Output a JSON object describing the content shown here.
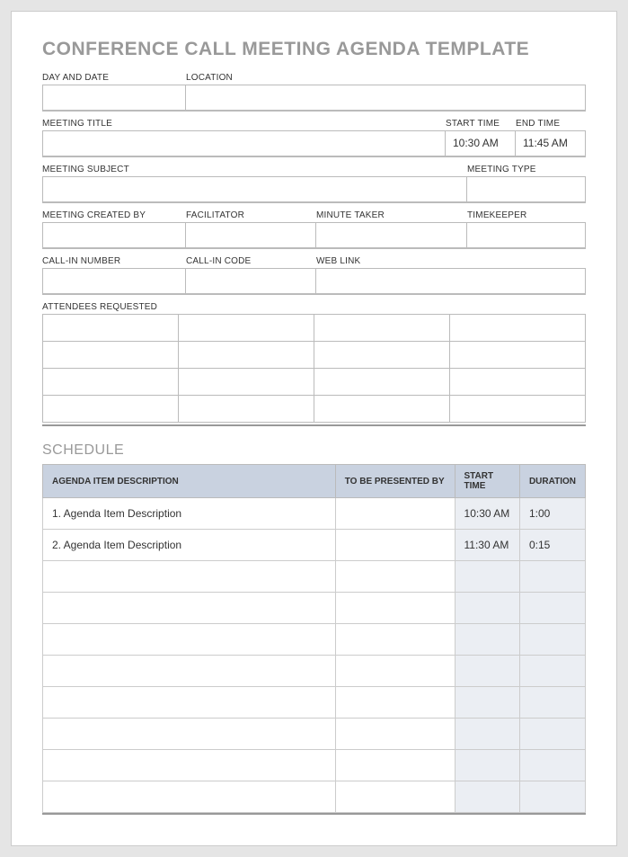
{
  "title": "CONFERENCE CALL MEETING AGENDA TEMPLATE",
  "labels": {
    "day_date": "DAY AND DATE",
    "location": "LOCATION",
    "meeting_title": "MEETING TITLE",
    "start_time": "START TIME",
    "end_time": "END TIME",
    "meeting_subject": "MEETING SUBJECT",
    "meeting_type": "MEETING TYPE",
    "created_by": "MEETING CREATED BY",
    "facilitator": "FACILITATOR",
    "minute_taker": "MINUTE TAKER",
    "timekeeper": "TIMEKEEPER",
    "callin_number": "CALL-IN NUMBER",
    "callin_code": "CALL-IN CODE",
    "web_link": "WEB LINK",
    "attendees": "ATTENDEES REQUESTED"
  },
  "values": {
    "day_date": "",
    "location": "",
    "meeting_title": "",
    "start_time": "10:30 AM",
    "end_time": "11:45 AM",
    "meeting_subject": "",
    "meeting_type": "",
    "created_by": "",
    "facilitator": "",
    "minute_taker": "",
    "timekeeper": "",
    "callin_number": "",
    "callin_code": "",
    "web_link": ""
  },
  "schedule_section": "SCHEDULE",
  "schedule_headers": {
    "desc": "AGENDA ITEM DESCRIPTION",
    "presenter": "TO BE PRESENTED BY",
    "start": "START TIME",
    "duration": "DURATION"
  },
  "schedule_rows": [
    {
      "desc": "1. Agenda Item Description",
      "presenter": "",
      "start": "10:30 AM",
      "duration": "1:00"
    },
    {
      "desc": "2. Agenda Item Description",
      "presenter": "",
      "start": "11:30 AM",
      "duration": "0:15"
    },
    {
      "desc": "",
      "presenter": "",
      "start": "",
      "duration": ""
    },
    {
      "desc": "",
      "presenter": "",
      "start": "",
      "duration": ""
    },
    {
      "desc": "",
      "presenter": "",
      "start": "",
      "duration": ""
    },
    {
      "desc": "",
      "presenter": "",
      "start": "",
      "duration": ""
    },
    {
      "desc": "",
      "presenter": "",
      "start": "",
      "duration": ""
    },
    {
      "desc": "",
      "presenter": "",
      "start": "",
      "duration": ""
    },
    {
      "desc": "",
      "presenter": "",
      "start": "",
      "duration": ""
    },
    {
      "desc": "",
      "presenter": "",
      "start": "",
      "duration": ""
    }
  ]
}
